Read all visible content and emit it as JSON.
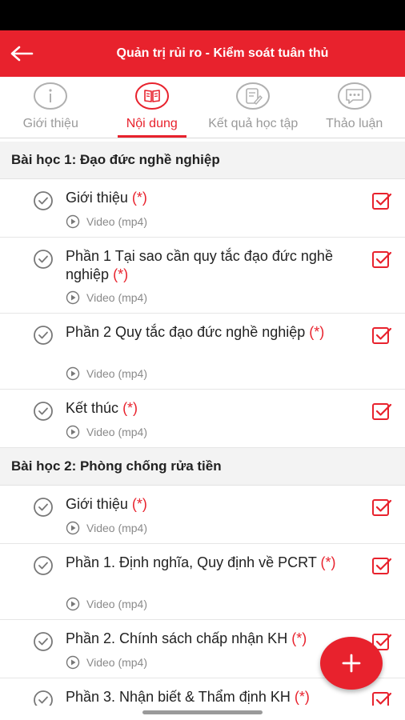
{
  "header": {
    "title": "Quản trị rủi ro - Kiểm soát tuân thủ",
    "accent": "#e8222d"
  },
  "tabs": [
    {
      "label": "Giới thiệu",
      "icon": "info-icon"
    },
    {
      "label": "Nội dung",
      "icon": "book-icon"
    },
    {
      "label": "Kết quả học tập",
      "icon": "clipboard-edit-icon"
    },
    {
      "label": "Thảo luận",
      "icon": "chat-dots-icon"
    }
  ],
  "lessons": [
    {
      "title": "Bài học 1: Đạo đức nghề nghiệp",
      "items": [
        {
          "title": "Giới thiệu",
          "required": "(*)",
          "type": "Video (mp4)"
        },
        {
          "title": "Phần 1 Tại sao cần quy tắc đạo đức nghề nghiệp",
          "required": "(*)",
          "type": "Video (mp4)"
        },
        {
          "title": "Phần 2 Quy tắc đạo đức nghề nghiệp",
          "required": "(*)",
          "type": "Video (mp4)"
        },
        {
          "title": "Kết thúc",
          "required": "(*)",
          "type": "Video (mp4)"
        }
      ]
    },
    {
      "title": "Bài học 2: Phòng chống rửa tiền",
      "items": [
        {
          "title": "Giới thiệu",
          "required": "(*)",
          "type": "Video (mp4)"
        },
        {
          "title": "Phần 1. Định nghĩa, Quy định về PCRT",
          "required": "(*)",
          "type": "Video (mp4)"
        },
        {
          "title": "Phần 2. Chính sách chấp nhận KH",
          "required": "(*)",
          "type": "Video (mp4)"
        },
        {
          "title": "Phần 3. Nhận biết & Thẩm định KH",
          "required": "(*)",
          "type": ""
        }
      ]
    }
  ],
  "fab": {
    "icon": "plus-icon"
  }
}
